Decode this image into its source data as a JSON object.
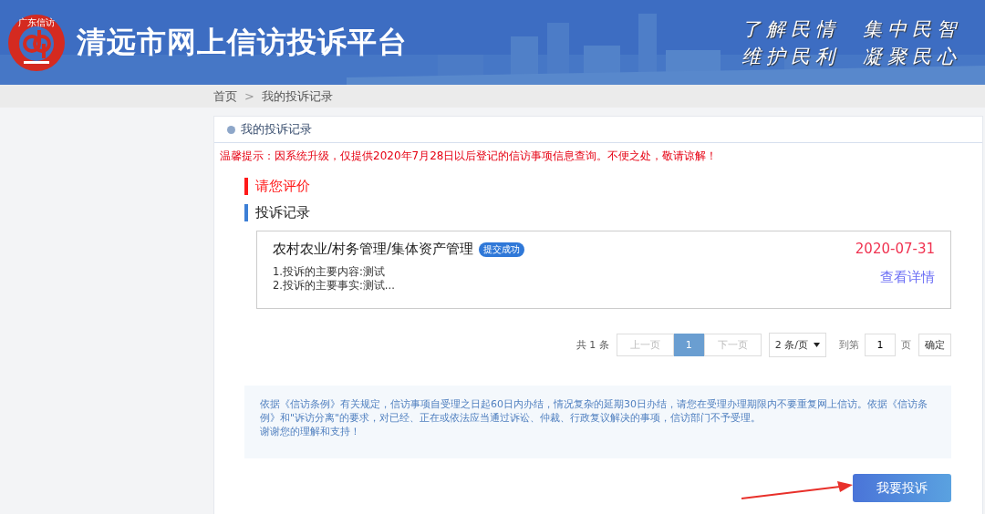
{
  "header": {
    "logo_text": "广东信访",
    "title": "清远市网上信访投诉平台",
    "slogans": [
      "了解民情  集中民智",
      "维护民利  凝聚民心"
    ]
  },
  "breadcrumb": [
    "首页",
    ">",
    "我的投诉记录"
  ],
  "panel_title": "我的投诉记录",
  "warning": "温馨提示：因系统升级，仅提供2020年7月28日以后登记的信访事项信息查询。不便之处，敬请谅解！",
  "sections": [
    {
      "title": "请您评价",
      "color": "#ff1a1a"
    },
    {
      "title": "投诉记录",
      "color": "#3d7fd6"
    }
  ],
  "records": [
    {
      "category": "农村农业/村务管理/集体资产管理",
      "status": "提交成功",
      "date": "2020-07-31",
      "lines": [
        "1.投诉的主要内容:测试",
        "2.投诉的主要事实:测试..."
      ],
      "detail_link": "查看详情"
    }
  ],
  "pagination": {
    "total": "共 1 条",
    "prev": "上一页",
    "pages": [
      {
        "label": "1",
        "selected": true
      }
    ],
    "next": "下一页",
    "page_size": "2 条/页",
    "goto_label": "到第",
    "goto_value": "1",
    "page_unit": "页",
    "confirm": "确定"
  },
  "notice": [
    "依据《信访条例》有关规定，信访事项自受理之日起60日内办结，情况复杂的延期30日办结，请您在受理办理期限内不要重复网上信访。依据《信访条例》和\"诉访分离\"的要求，对已经、正在或依法应当通过诉讼、仲裁、行政复议解决的事项，信访部门不予受理。",
    "谢谢您的理解和支持！"
  ],
  "submit_button": "我要投诉"
}
